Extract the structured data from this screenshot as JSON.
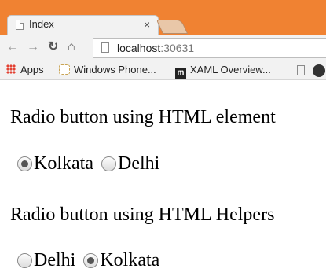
{
  "browser": {
    "tab_title": "Index",
    "tab_close": "×",
    "url_host": "localhost",
    "url_port": ":30631"
  },
  "bookmarks": {
    "apps": "Apps",
    "windows_phone": "Windows Phone...",
    "xaml_overview": "XAML Overview...",
    "xaml_icon_letter": "m"
  },
  "page": {
    "heading_html": "Radio button using HTML element",
    "heading_helpers": "Radio button using HTML Helpers",
    "group1": [
      {
        "label": "Kolkata",
        "checked": true
      },
      {
        "label": "Delhi",
        "checked": false
      }
    ],
    "group2": [
      {
        "label": "Delhi",
        "checked": false
      },
      {
        "label": "Kolkata",
        "checked": true
      }
    ]
  }
}
